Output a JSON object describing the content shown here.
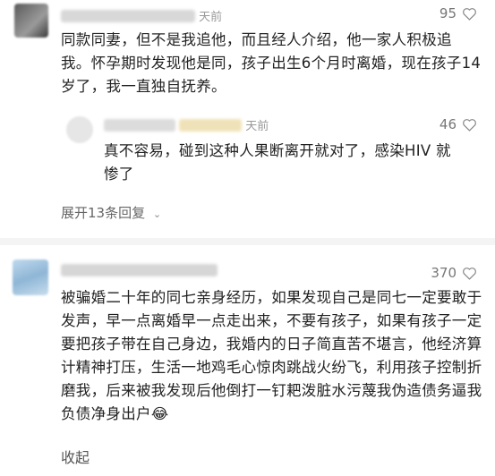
{
  "comments": [
    {
      "time": "天前",
      "likes": "95",
      "text": "同款同妻，但不是我追他，而且经人介绍，他一家人积极追我。怀孕期时发现他是同，孩子出生6个月时离婚，现在孩子14岁了，我一直独自抚养。",
      "reply": {
        "time": "天前",
        "likes": "46",
        "text": "真不容易，碰到这种人果断离开就对了，感染HIV 就惨了"
      },
      "expand_label": "展开13条回复"
    },
    {
      "likes": "370",
      "text": "被骗婚二十年的同七亲身经历，如果发现自己是同七一定要敢于发声，早一点离婚早一点走出来，不要有孩子，如果有孩子一定要把孩子带在自己身边，我婚内的日子简直苦不堪言，他经济算计精神打压，生活一地鸡毛心惊肉跳战火纷飞，利用孩子控制折磨我，后来被我发现后他倒打一钉耙泼脏水污蔑我伪造债务逼我负债净身出户",
      "emoji": "😂",
      "collapse_label": "收起"
    }
  ]
}
